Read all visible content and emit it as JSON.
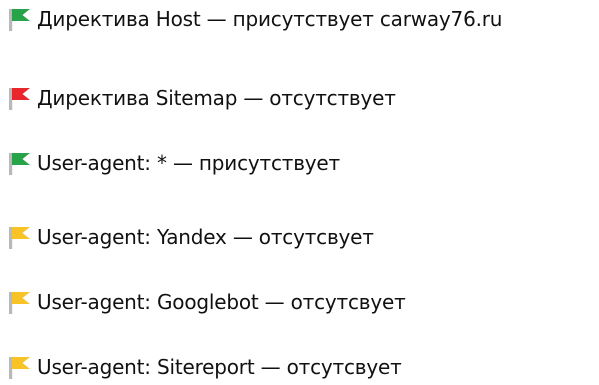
{
  "items": [
    {
      "text": "Директива Host — присутствует carway76.ru",
      "status": "present",
      "flag_icon": "green-flag-icon",
      "color": "#27a34a"
    },
    {
      "text": "Директива Sitemap — отсутствует",
      "status": "absent",
      "flag_icon": "red-flag-icon",
      "color": "#e8262c"
    },
    {
      "text": "User-agent: * — присутствует",
      "status": "present",
      "flag_icon": "green-flag-icon",
      "color": "#27a34a"
    },
    {
      "text": "User-agent: Yandex — отсутсвует",
      "status": "warning",
      "flag_icon": "yellow-flag-icon",
      "color": "#f7c325"
    },
    {
      "text": "User-agent: Googlebot — отсутсвует",
      "status": "warning",
      "flag_icon": "yellow-flag-icon",
      "color": "#f7c325"
    },
    {
      "text": "User-agent: Sitereport — отсутсвует",
      "status": "warning",
      "flag_icon": "yellow-flag-icon",
      "color": "#f7c325"
    }
  ]
}
